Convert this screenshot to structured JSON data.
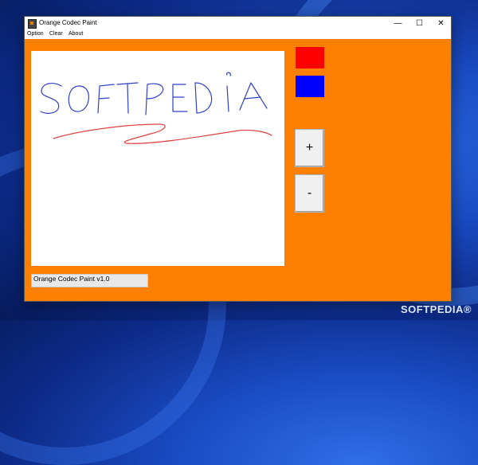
{
  "window": {
    "title": "Orange Codec Paint",
    "controls": {
      "minimize": "—",
      "maximize": "☐",
      "close": "✕"
    }
  },
  "menu": {
    "items": [
      "Option",
      "Clear",
      "About"
    ]
  },
  "palette": {
    "colors": [
      "#ff0000",
      "#0000ff"
    ]
  },
  "buttons": {
    "plus": "+",
    "minus": "-"
  },
  "status": {
    "text": "Orange Codec Paint v1.0"
  },
  "canvas": {
    "drawn_text": "SOFTPEDIA"
  },
  "theme": {
    "background": "#ff8000"
  },
  "watermark": "SOFTPEDIA®"
}
